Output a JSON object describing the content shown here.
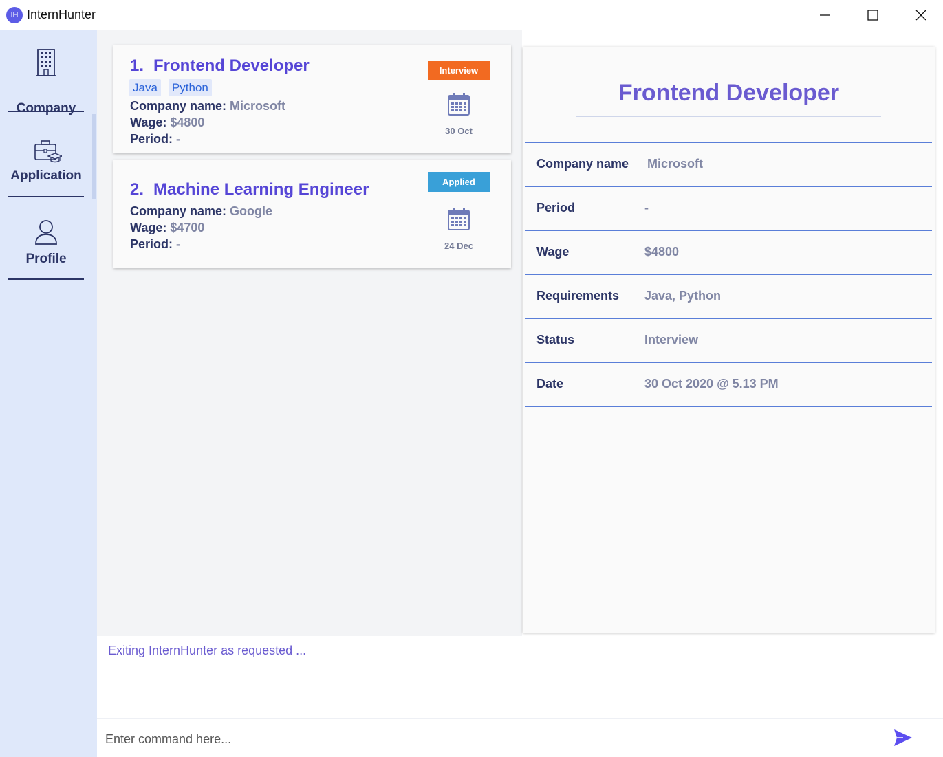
{
  "window": {
    "logo_text": "IH",
    "title": "InternHunter"
  },
  "sidebar": {
    "items": [
      {
        "label": "Company",
        "icon": "building-icon"
      },
      {
        "label": "Application",
        "icon": "briefcase-graduation-icon"
      },
      {
        "label": "Profile",
        "icon": "user-icon"
      }
    ]
  },
  "applications": [
    {
      "index": "1.",
      "title": "Frontend Developer",
      "tags": [
        "Java",
        "Python"
      ],
      "company_label": "Company name:",
      "company": "Microsoft",
      "wage_label": "Wage:",
      "wage": "$4800",
      "period_label": "Period:",
      "period": "-",
      "status": "Interview",
      "status_color": "#f26a21",
      "date": "30 Oct"
    },
    {
      "index": "2.",
      "title": "Machine Learning Engineer",
      "tags": [],
      "company_label": "Company name:",
      "company": "Google",
      "wage_label": "Wage:",
      "wage": "$4700",
      "period_label": "Period:",
      "period": "-",
      "status": "Applied",
      "status_color": "#39a0d8",
      "date": "24 Dec"
    }
  ],
  "detail": {
    "title": "Frontend Developer",
    "rows": [
      {
        "key": "Company name",
        "value": "Microsoft"
      },
      {
        "key": "Period",
        "value": "-"
      },
      {
        "key": "Wage",
        "value": "$4800"
      },
      {
        "key": "Requirements",
        "value": "Java, Python"
      },
      {
        "key": "Status",
        "value": "Interview"
      },
      {
        "key": "Date",
        "value": "30 Oct 2020 @ 5.13 PM"
      }
    ]
  },
  "result": {
    "text": "Exiting InternHunter as requested ..."
  },
  "command": {
    "placeholder": "Enter command here...",
    "value": ""
  },
  "colors": {
    "accent": "#5545d6",
    "sidebar_bg": "#dfe8fa",
    "nav_text": "#2c3566",
    "send": "#5c4ef0"
  }
}
